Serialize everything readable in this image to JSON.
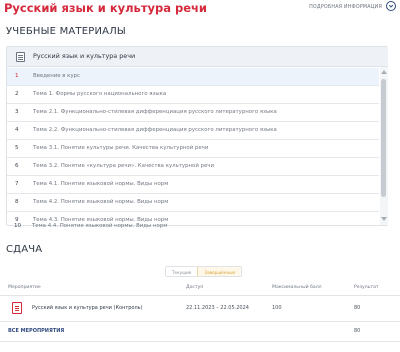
{
  "header": {
    "title": "Русский язык и культура речи",
    "details_link": "ПОДРОБНАЯ ИНФОРМАЦИЯ",
    "expand_icon": "chevron-down-icon"
  },
  "materials": {
    "section_title": "УЧЕБНЫЕ МАТЕРИАЛЫ",
    "course_name": "Русский язык и культура речи",
    "lessons": [
      {
        "num": "1",
        "title": "Введение в курс"
      },
      {
        "num": "2",
        "title": "Тема 1. Формы русского национального языка"
      },
      {
        "num": "3",
        "title": "Тема 2.1. Функционально-стилевая дифференциация русского литературного языка"
      },
      {
        "num": "4",
        "title": "Тема 2.2. Функционально-стилевая дифференциация русского литературного языка"
      },
      {
        "num": "5",
        "title": "Тема 3.1. Понятие культуры речи. Качества культурной речи"
      },
      {
        "num": "6",
        "title": "Тема 3.2. Понятие «культура речи». Качества культурной речи"
      },
      {
        "num": "7",
        "title": "Тема 4.1. Понятие языковой нормы. Виды норм"
      },
      {
        "num": "8",
        "title": "Тема 4.2. Понятие языковой нормы. Виды норм"
      },
      {
        "num": "9",
        "title": "Тема 4.3. Понятие языковой нормы. Виды норм"
      },
      {
        "num": "10",
        "title": "Тема 4.4. Понятие языковой нормы. Виды норм"
      }
    ]
  },
  "submission": {
    "section_title": "СДАЧА",
    "tabs": [
      "Текущие",
      "Завершённые"
    ],
    "columns": {
      "event": "Мероприятие",
      "access": "Доступ",
      "max_score": "Максимальный балл",
      "result": "Результат"
    },
    "rows": [
      {
        "event": "Русский язык и культура речи (Контроль)",
        "access": "22.11.2023 – 22.05.2024",
        "max_score": "100",
        "result": "80"
      }
    ],
    "all_events_label": "ВСЕ МЕРОПРИЯТИЯ",
    "all_events_result": "80"
  },
  "colors": {
    "accent": "#d52a3c",
    "link": "#2e4a7d",
    "active_tab": "#d8a13a"
  }
}
